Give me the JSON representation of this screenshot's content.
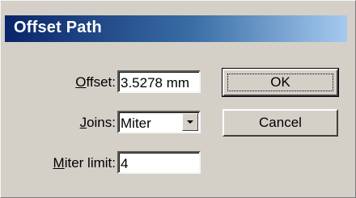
{
  "window": {
    "title": "Offset Path"
  },
  "fields": {
    "offset": {
      "label_accel": "O",
      "label_rest": "ffset:",
      "value": "3.5278 mm"
    },
    "joins": {
      "label_accel": "J",
      "label_rest": "oins:",
      "value": "Miter",
      "icon": "chevron-down-icon"
    },
    "miter_limit": {
      "label_accel": "M",
      "label_rest": "iter limit:",
      "value": "4"
    }
  },
  "buttons": {
    "ok": "OK",
    "cancel": "Cancel"
  },
  "colors": {
    "dialog_bg": "#d4d0c8",
    "titlebar_start": "#0a246a",
    "titlebar_end": "#a6caf0"
  }
}
